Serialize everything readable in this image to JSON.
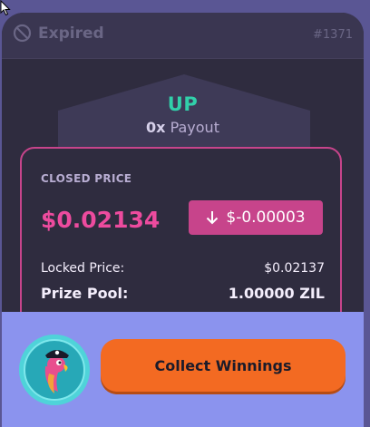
{
  "header": {
    "status_label": "Expired",
    "epoch": "#1371"
  },
  "direction": {
    "label": "UP",
    "payout_multiplier": "0x",
    "payout_label": "Payout"
  },
  "price": {
    "closed_label": "CLOSED PRICE",
    "closed_value": "$0.02134",
    "change_value": "$-0.00003",
    "locked_label": "Locked Price:",
    "locked_value": "$0.02137",
    "pool_label": "Prize Pool:",
    "pool_value": "1.00000 ZIL"
  },
  "footer": {
    "collect_label": "Collect Winnings"
  },
  "colors": {
    "accent_up": "#31d0aa",
    "accent_down": "#ed4b9e",
    "badge_down": "#c7448b",
    "button": "#f36a22",
    "footer_bg": "#8b93ee"
  },
  "icons": [
    "cursor-icon",
    "block-icon",
    "arrow-down-icon",
    "parrot-pirate-icon"
  ]
}
